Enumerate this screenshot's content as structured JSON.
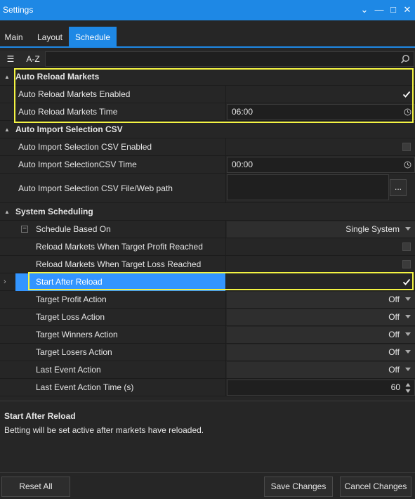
{
  "window": {
    "title": "Settings",
    "controls": {
      "dropdown_glyph": "⌄",
      "minimize_glyph": "—",
      "maximize_glyph": "□",
      "close_glyph": "✕"
    }
  },
  "tabs": [
    {
      "label": "Main",
      "active": false
    },
    {
      "label": "Layout",
      "active": false
    },
    {
      "label": "Schedule",
      "active": true
    }
  ],
  "toolbar": {
    "categorized_glyph": "☰",
    "az_label": "A-Z",
    "search_value": ""
  },
  "grid": {
    "categories": [
      {
        "title": "Auto Reload Markets",
        "rows": [
          {
            "label": "Auto Reload Markets Enabled",
            "type": "checkbox",
            "checked": true
          },
          {
            "label": "Auto Reload Markets Time",
            "type": "time",
            "value": "06:00"
          }
        ]
      },
      {
        "title": "Auto Import Selection CSV",
        "rows": [
          {
            "label": "Auto Import Selection CSV Enabled",
            "type": "checkbox",
            "checked": false
          },
          {
            "label": "Auto Import SelectionCSV Time",
            "type": "time",
            "value": "00:00"
          },
          {
            "label": "Auto Import Selection CSV File/Web path",
            "type": "path",
            "value": "",
            "browse_label": "..."
          }
        ]
      },
      {
        "title": "System Scheduling",
        "rows": [
          {
            "label": "Schedule Based On",
            "type": "dropdown",
            "value": "Single System",
            "expandable": true,
            "expand_glyph": "−"
          },
          {
            "label": "Reload Markets When Target Profit Reached",
            "type": "checkbox",
            "checked": false
          },
          {
            "label": "Reload Markets When Target Loss Reached",
            "type": "checkbox",
            "checked": false
          },
          {
            "label": "Start After Reload",
            "type": "checkbox",
            "checked": true,
            "selected": true
          },
          {
            "label": "Target Profit Action",
            "type": "dropdown",
            "value": "Off"
          },
          {
            "label": "Target Loss Action",
            "type": "dropdown",
            "value": "Off"
          },
          {
            "label": "Target Winners Action",
            "type": "dropdown",
            "value": "Off"
          },
          {
            "label": "Target Losers Action",
            "type": "dropdown",
            "value": "Off"
          },
          {
            "label": "Last Event Action",
            "type": "dropdown",
            "value": "Off"
          },
          {
            "label": "Last Event Action Time (s)",
            "type": "number",
            "value": "60"
          }
        ]
      }
    ]
  },
  "description": {
    "title": "Start After Reload",
    "body": "Betting will be set active after markets have reloaded."
  },
  "footer": {
    "reset_label": "Reset All",
    "save_label": "Save Changes",
    "cancel_label": "Cancel Changes"
  },
  "colors": {
    "accent": "#1e88e5",
    "selection": "#3395ff",
    "highlight": "#f4f442",
    "background": "#262626"
  }
}
